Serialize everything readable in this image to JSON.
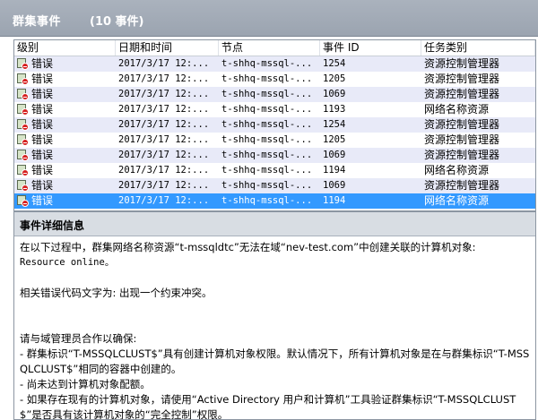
{
  "header": {
    "title": "群集事件",
    "count": "(10 事件)"
  },
  "table": {
    "columns": [
      "级别",
      "日期和时间",
      "节点",
      "事件 ID",
      "任务类别"
    ],
    "rows": [
      {
        "level": "错误",
        "datetime": "2017/3/17 12:...",
        "node": "t-shhq-mssql-...",
        "event_id": "1254",
        "category": "资源控制管理器"
      },
      {
        "level": "错误",
        "datetime": "2017/3/17 12:...",
        "node": "t-shhq-mssql-...",
        "event_id": "1205",
        "category": "资源控制管理器"
      },
      {
        "level": "错误",
        "datetime": "2017/3/17 12:...",
        "node": "t-shhq-mssql-...",
        "event_id": "1069",
        "category": "资源控制管理器"
      },
      {
        "level": "错误",
        "datetime": "2017/3/17 12:...",
        "node": "t-shhq-mssql-...",
        "event_id": "1193",
        "category": "网络名称资源"
      },
      {
        "level": "错误",
        "datetime": "2017/3/17 12:...",
        "node": "t-shhq-mssql-...",
        "event_id": "1254",
        "category": "资源控制管理器"
      },
      {
        "level": "错误",
        "datetime": "2017/3/17 12:...",
        "node": "t-shhq-mssql-...",
        "event_id": "1205",
        "category": "资源控制管理器"
      },
      {
        "level": "错误",
        "datetime": "2017/3/17 12:...",
        "node": "t-shhq-mssql-...",
        "event_id": "1069",
        "category": "资源控制管理器"
      },
      {
        "level": "错误",
        "datetime": "2017/3/17 12:...",
        "node": "t-shhq-mssql-...",
        "event_id": "1194",
        "category": "网络名称资源"
      },
      {
        "level": "错误",
        "datetime": "2017/3/17 12:...",
        "node": "t-shhq-mssql-...",
        "event_id": "1069",
        "category": "资源控制管理器"
      },
      {
        "level": "错误",
        "datetime": "2017/3/17 12:...",
        "node": "t-shhq-mssql-...",
        "event_id": "1194",
        "category": "网络名称资源"
      }
    ],
    "selected_row": 9
  },
  "detail": {
    "title": "事件详细信息",
    "line1": "在以下过程中，群集网络名称资源“t-mssqldtc”无法在域“nev-test.com”中创建关联的计算机对象:",
    "line2": "Resource online。",
    "line3": "相关错误代码文字为: 出现一个约束冲突。",
    "line4": "请与域管理员合作以确保:",
    "line5": "- 群集标识“T-MSSQLCLUST$”具有创建计算机对象权限。默认情况下，所有计算机对象是在与群集标识“T-MSSQLCLUST$”相同的容器中创建的。",
    "line6": "- 尚未达到计算机对象配额。",
    "line7": "- 如果存在现有的计算机对象，请使用“Active Directory 用户和计算机”工具验证群集标识“T-MSSQLCLUST$”是否具有该计算机对象的“完全控制”权限。"
  },
  "colors": {
    "header_bg": "#9ba4b0",
    "row_alt": "#e8eaf8",
    "row_selected": "#3399ff",
    "error_icon": "#d62020"
  },
  "icons": {
    "level_icon": "error-icon"
  }
}
